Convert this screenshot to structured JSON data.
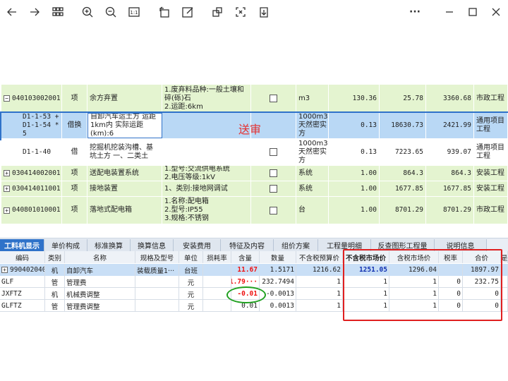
{
  "toolbar": {
    "icons": [
      "back-arrow-icon",
      "forward-arrow-icon",
      "grid-view-icon",
      "zoom-in-icon",
      "zoom-out-icon",
      "actual-size-icon",
      "rotate-icon",
      "edit-icon",
      "crop-icon",
      "fit-screen-icon",
      "download-icon",
      "more-icon",
      "minimize-icon",
      "maximize-icon",
      "close-icon"
    ],
    "actual_size_label": "1:1",
    "more_label": "···"
  },
  "upper_rows": [
    {
      "code": "040103002001",
      "type": "项",
      "name": "余方弃置",
      "feature": "1.废弃料品种:一般土壤和碎(砾)石\n2.运距:6km",
      "unit": "m3",
      "qty": "130.36",
      "price": "25.78",
      "total": "3360.68",
      "major": "市政工程",
      "expand": "−"
    },
    {
      "code": "D1-1-53 +\nD1-1-54 * 5",
      "type": "借换",
      "name": "自卸汽车运土方 运距1km内  实际运距(km):6",
      "feature": "",
      "unit": "1000m3天然密实方",
      "qty": "0.13",
      "price": "18630.73",
      "total": "2421.99",
      "major": "通用项目工程"
    },
    {
      "code": "D1-1-40",
      "type": "借",
      "name": "挖掘机挖装沟槽、基坑土方 一、二类土",
      "feature": "",
      "unit": "1000m3天然密实方",
      "qty": "0.13",
      "price": "7223.65",
      "total": "939.07",
      "major": "通用项目工程"
    },
    {
      "code": "030414002001",
      "type": "项",
      "name": "送配电装置系统",
      "feature": "1.型号:交流供电系统\n2.电压等级:1kV",
      "unit": "系统",
      "qty": "1.00",
      "price": "864.3",
      "total": "864.3",
      "major": "安装工程",
      "expand": "+"
    },
    {
      "code": "030414011001",
      "type": "项",
      "name": "接地装置",
      "feature": "1、类别:接地网调试",
      "unit": "系统",
      "qty": "1.00",
      "price": "1677.85",
      "total": "1677.85",
      "major": "安装工程",
      "expand": "+"
    },
    {
      "code": "040801010001",
      "type": "项",
      "name": "落地式配电箱",
      "feature": "1.名称:配电箱\n2.型号:IP55\n3.规格:不锈钢",
      "unit": "台",
      "qty": "1.00",
      "price": "8701.29",
      "total": "8701.29",
      "major": "市政工程",
      "expand": "+"
    }
  ],
  "stamp_text": "送审",
  "tabs": [
    "工料机显示",
    "单价构成",
    "标准换算",
    "换算信息",
    "安装费用",
    "特征及内容",
    "组价方案",
    "工程量明细",
    "反查图形工程量",
    "说明信息"
  ],
  "lower_headers": [
    "编码",
    "类别",
    "名称",
    "规格及型号",
    "单位",
    "损耗率",
    "含量",
    "数量",
    "不含税预算价",
    "不含税市场价",
    "含税市场价",
    "税率",
    "合价",
    "是"
  ],
  "lower_rows": [
    {
      "code": "990402040",
      "cat": "机",
      "name": "自卸汽车",
      "spec": "装载质量1···",
      "unit": "台班",
      "loss": "",
      "content": "11.67",
      "qty": "1.5171",
      "budget": "1216.62",
      "market": "1251.05",
      "tax_market": "1296.04",
      "tax_rate": "",
      "total": "1897.97",
      "expand": "+"
    },
    {
      "code": "GLF",
      "cat": "管",
      "name": "管理费",
      "spec": "",
      "unit": "元",
      "loss": "",
      "content": "1.79···",
      "qty": "232.7494",
      "budget": "1",
      "market": "1",
      "tax_market": "1",
      "tax_rate": "0",
      "total": "232.75"
    },
    {
      "code": "JXFTZ",
      "cat": "机",
      "name": "机械费调整",
      "spec": "",
      "unit": "元",
      "loss": "",
      "content": "-0.01",
      "qty": "-0.0013",
      "budget": "1",
      "market": "1",
      "tax_market": "1",
      "tax_rate": "0",
      "total": "0"
    },
    {
      "code": "GLFTZ",
      "cat": "管",
      "name": "管理费调整",
      "spec": "",
      "unit": "元",
      "loss": "",
      "content": "0.01",
      "qty": "0.0013",
      "budget": "1",
      "market": "1",
      "tax_market": "1",
      "tax_rate": "0",
      "total": "0"
    }
  ],
  "colors": {
    "highlight_box": "#e02020",
    "oval": "#1fa01f",
    "stamp": "#e53030",
    "active_tab": "#2f72c9",
    "selected_row": "#b9d8f5",
    "measure_row": "#e4f4d0"
  }
}
